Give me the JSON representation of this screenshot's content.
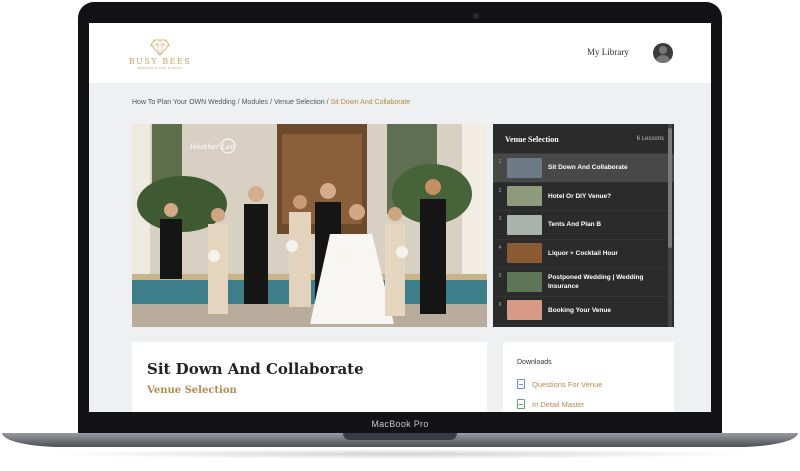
{
  "device": {
    "label": "MacBook Pro"
  },
  "header": {
    "logo": {
      "name": "BUSY BEES",
      "tagline": "WEDDINGS AND EVENTS"
    },
    "nav_link": "My Library"
  },
  "breadcrumb": {
    "items": [
      "How To Plan Your OWN Wedding",
      "Modules",
      "Venue Selection",
      "Sit Down And Collaborate"
    ],
    "separator": "/"
  },
  "photo": {
    "watermark": "Heather Lee"
  },
  "playlist": {
    "title": "Venue Selection",
    "count": "6 Lessons",
    "items": [
      {
        "num": "1",
        "label": "Sit Down And Collaborate",
        "active": true,
        "thumb": "#6d7a86"
      },
      {
        "num": "2",
        "label": "Hotel Or DIY Venue?",
        "active": false,
        "thumb": "#8f9a7c"
      },
      {
        "num": "3",
        "label": "Tents And Plan B",
        "active": false,
        "thumb": "#a9b2ab"
      },
      {
        "num": "4",
        "label": "Liquor + Cocktail Hour",
        "active": false,
        "thumb": "#8a5a32"
      },
      {
        "num": "5",
        "label": "Postponed Wedding | Wedding Insurance",
        "active": false,
        "thumb": "#5d7657"
      },
      {
        "num": "6",
        "label": "Booking Your Venue",
        "active": false,
        "thumb": "#d69a86"
      }
    ]
  },
  "content": {
    "title": "Sit Down And Collaborate",
    "subtitle": "Venue Selection"
  },
  "downloads": {
    "heading": "Downloads",
    "items": [
      {
        "label": "Questions For Venue",
        "icon": "document-icon"
      },
      {
        "label": "In Detail Master",
        "icon": "spreadsheet-icon"
      }
    ]
  },
  "colors": {
    "accent": "#b48a4e",
    "playlist_bg": "#2b2b2b",
    "page_bg": "#eef0f2"
  }
}
